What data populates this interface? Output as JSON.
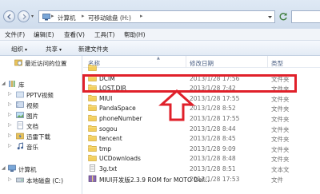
{
  "address_bar": {
    "crumbs": [
      "计算机",
      "可移动磁盘 (H:)"
    ]
  },
  "menu": [
    "文件(F)",
    "编辑(E)",
    "查看(V)",
    "工具(T)",
    "帮助(H)"
  ],
  "toolbar": {
    "organize": "组织",
    "share": "共享",
    "new_folder": "新建文件夹"
  },
  "nav": {
    "recent": "最近访问的位置",
    "library": "库",
    "pptv": "PPTV视频",
    "videos": "视频",
    "pictures": "图片",
    "documents": "文档",
    "thunder": "迅雷下载",
    "music": "音乐",
    "computer": "计算机",
    "local_disk": "本地磁盘 (C:)"
  },
  "columns": {
    "name": "名称",
    "modified": "修改日期",
    "type": "类型"
  },
  "files": [
    {
      "name": "",
      "date": "",
      "type": "",
      "icon": "folder-icon"
    },
    {
      "name": "DCIM",
      "date": "2013/1/28 17:56",
      "type": "文件夹",
      "icon": "folder-icon"
    },
    {
      "name": "LOST.DIR",
      "date": "2013/1/28 7:42",
      "type": "文件夹",
      "icon": "folder-icon"
    },
    {
      "name": "MIUI",
      "date": "2013/1/28 17:55",
      "type": "文件夹",
      "icon": "folder-icon"
    },
    {
      "name": "PandaSpace",
      "date": "2013/1/28 8:52",
      "type": "文件夹",
      "icon": "folder-icon"
    },
    {
      "name": "phoneNumber",
      "date": "2013/1/28 17:55",
      "type": "文件夹",
      "icon": "folder-icon"
    },
    {
      "name": "sogou",
      "date": "2013/1/28 8:44",
      "type": "文件夹",
      "icon": "folder-icon"
    },
    {
      "name": "tencent",
      "date": "2013/1/28 8:45",
      "type": "文件夹",
      "icon": "folder-icon"
    },
    {
      "name": "tmp",
      "date": "2013/1/28 9:09",
      "type": "文件夹",
      "icon": "folder-icon"
    },
    {
      "name": "UCDownloads",
      "date": "2013/1/28 8:48",
      "type": "文件夹",
      "icon": "folder-icon"
    },
    {
      "name": "3g.txt",
      "date": "2013/1/28 8:51",
      "type": "文本文",
      "icon": "text-file-icon"
    },
    {
      "name": "MIUI开发版2.3.9 ROM for MOTO Def...",
      "date": "2013/1/28 17:53",
      "type": "文件",
      "icon": "zip-file-icon"
    }
  ],
  "colors": {
    "annotation_red": "#e0202a",
    "folder_yellow": "#f3cf5c"
  }
}
